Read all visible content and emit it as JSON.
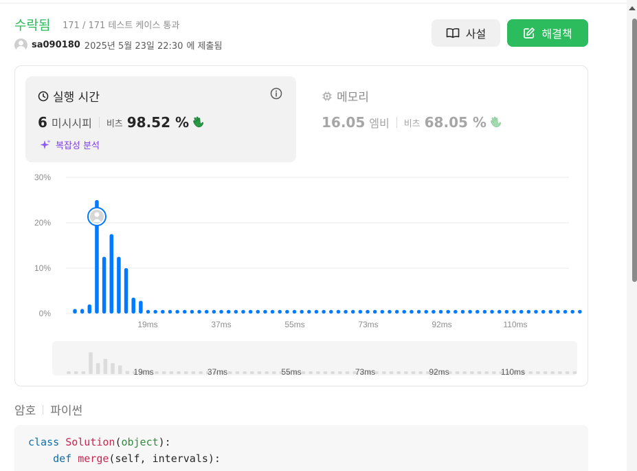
{
  "submission": {
    "status": "수락됨",
    "tests_passed": "171 / 171 테스트 케이스 통과",
    "username": "sa090180",
    "submitted_at": "2025년 5월 23일 22:30",
    "submitted_suffix": "에 제출됨",
    "status_color": "#2cbb5d"
  },
  "actions": {
    "solution_label": "사설",
    "solution_icon": "book-icon",
    "edit_label": "해결책",
    "edit_icon": "edit-icon",
    "accent": "#2cbb5d"
  },
  "runtime": {
    "title": "실행 시간",
    "value": "6",
    "unit": "미시시피",
    "beats_label": "비츠",
    "beats": "98.52 %",
    "complexity_label": "복잡성 분석"
  },
  "memory": {
    "title": "메모리",
    "value": "16.05",
    "unit": "엠비",
    "beats_label": "비츠",
    "beats": "68.05 %"
  },
  "chart_data": {
    "type": "bar",
    "y_ticks": [
      "30%",
      "20%",
      "10%",
      "0%"
    ],
    "ylim": [
      0,
      30
    ],
    "x_tick_labels": [
      "19ms",
      "37ms",
      "55ms",
      "73ms",
      "92ms",
      "110ms"
    ],
    "values": [
      1,
      1,
      2,
      25,
      12.5,
      17.5,
      12.5,
      10,
      3.5,
      2.8,
      0.8,
      0.8,
      0.8,
      0.8,
      0.8,
      0.8,
      0.8,
      0.8,
      0.8,
      0.8,
      0.8,
      0.8,
      0.8,
      0.8,
      0.8,
      0.8,
      0.8,
      0.8,
      0.8,
      0.8,
      0.8,
      0.8,
      0.8,
      0.8,
      0.8,
      0.8,
      0.8,
      0.8,
      0.8,
      0.8,
      0.8,
      0.8,
      0.8,
      0.8,
      0.8,
      0.8,
      0.8,
      0.8,
      0.8,
      0.8,
      0.8,
      0.8,
      0.8,
      0.8,
      0.8,
      0.8,
      0.8,
      0.8,
      0.8,
      0.8,
      0.8,
      0.8,
      0.8,
      0.8,
      0.8,
      0.8,
      0.8,
      0.8,
      0.8,
      0.8
    ],
    "highlight_index": 3,
    "bar_color": "#007aff",
    "grid": true
  },
  "code_section": {
    "label": "암호",
    "language": "파이썬",
    "lines": [
      [
        {
          "t": "class ",
          "c": "kw"
        },
        {
          "t": "Solution",
          "c": "cls"
        },
        {
          "t": "(",
          "c": ""
        },
        {
          "t": "object",
          "c": "base"
        },
        {
          "t": "):",
          "c": ""
        }
      ],
      [
        {
          "t": "    ",
          "c": ""
        },
        {
          "t": "def ",
          "c": "kw"
        },
        {
          "t": "merge",
          "c": "cls"
        },
        {
          "t": "(self, intervals):",
          "c": ""
        }
      ]
    ]
  }
}
